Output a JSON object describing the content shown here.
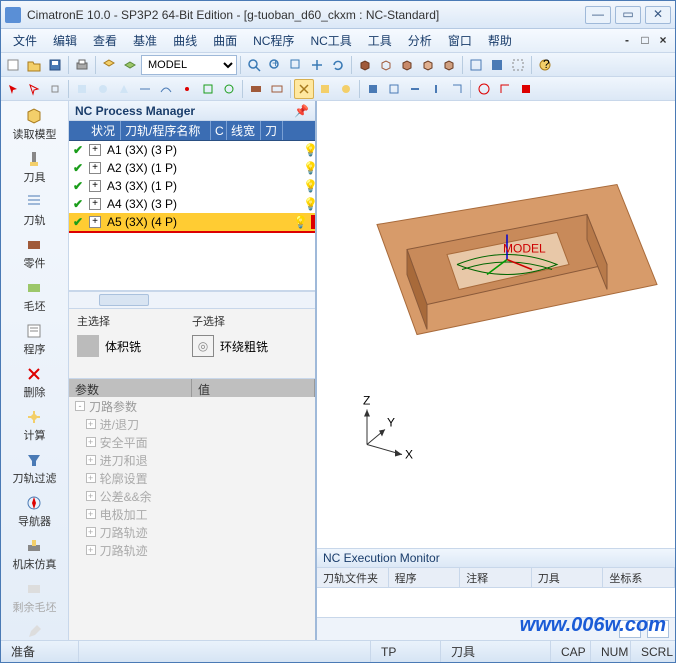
{
  "title": "CimatronE 10.0 - SP3P2 64-Bit Edition - [g-tuoban_d60_ckxm : NC-Standard]",
  "menus": [
    "文件",
    "编辑",
    "查看",
    "基准",
    "曲线",
    "曲面",
    "NC程序",
    "NC工具",
    "工具",
    "分析",
    "窗口",
    "帮助"
  ],
  "model_select": "MODEL",
  "sidebar": [
    {
      "label": "读取模型",
      "dis": false
    },
    {
      "label": "刀具",
      "dis": false
    },
    {
      "label": "刀轨",
      "dis": false
    },
    {
      "label": "零件",
      "dis": false
    },
    {
      "label": "毛坯",
      "dis": false
    },
    {
      "label": "程序",
      "dis": false
    },
    {
      "label": "删除",
      "dis": false
    },
    {
      "label": "计算",
      "dis": false
    },
    {
      "label": "刀轨过滤",
      "dis": false
    },
    {
      "label": "导航器",
      "dis": false
    },
    {
      "label": "机床仿真",
      "dis": false
    },
    {
      "label": "剩余毛坯",
      "dis": true
    },
    {
      "label": "刀轨编辑",
      "dis": true
    }
  ],
  "proc_panel_title": "NC Process Manager",
  "proc_cols": {
    "c1": "状况",
    "c2": "刀轨/程序名称",
    "c3": "C",
    "c4": "线宽",
    "c5": "刀"
  },
  "proc_rows": [
    {
      "name": "A1 (3X) (3 P)",
      "sel": false
    },
    {
      "name": "A2 (3X) (1 P)",
      "sel": false
    },
    {
      "name": "A3 (3X) (1 P)",
      "sel": false
    },
    {
      "name": "A4 (3X) (3 P)",
      "sel": false
    },
    {
      "name": "A5 (3X) (4 P)",
      "sel": true
    }
  ],
  "sel_panel": {
    "main_h": "主选择",
    "main_v": "体积铣",
    "sub_h": "子选择",
    "sub_v": "环绕粗铣"
  },
  "param_head": {
    "c1": "参数",
    "c2": "值"
  },
  "param_rows": [
    "刀路参数",
    "进/退刀",
    "安全平面",
    "进刀和退",
    "轮廓设置",
    "公差&&余",
    "电极加工",
    "刀路轨迹",
    "刀路轨迹"
  ],
  "exec_title": "NC Execution Monitor",
  "exec_cols": [
    "刀轨文件夹",
    "程序",
    "注释",
    "刀具",
    "坐标系"
  ],
  "status": {
    "ready": "准备",
    "tp": "TP",
    "tool": "刀具",
    "cap": "CAP",
    "num": "NUM",
    "scrl": "SCRL"
  },
  "axes": {
    "z": "Z",
    "y": "Y",
    "x": "X"
  },
  "watermark": "www.006w.com"
}
